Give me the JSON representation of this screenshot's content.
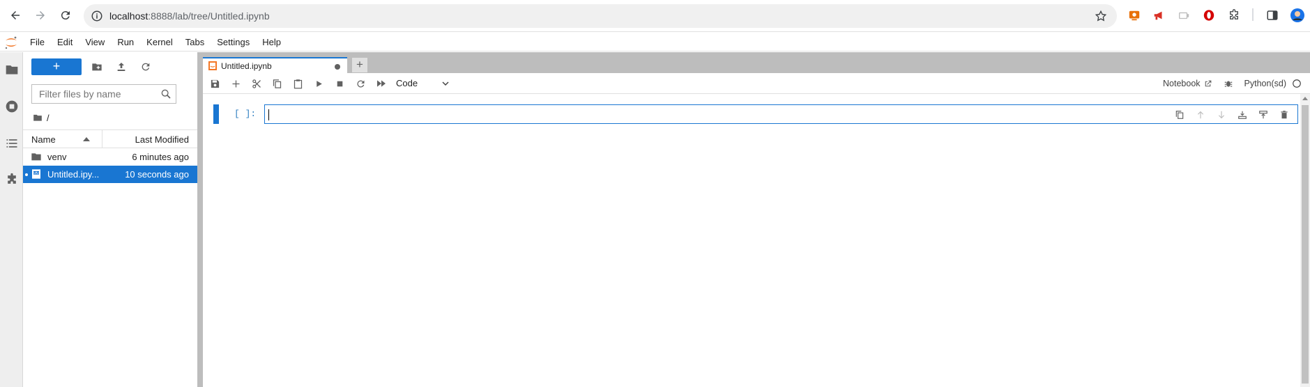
{
  "browser": {
    "url_host": "localhost",
    "url_path": ":8888/lab/tree/Untitled.ipynb"
  },
  "menubar": {
    "items": [
      "File",
      "Edit",
      "View",
      "Run",
      "Kernel",
      "Tabs",
      "Settings",
      "Help"
    ]
  },
  "filebrowser": {
    "new_label": "+",
    "filter_placeholder": "Filter files by name",
    "breadcrumb": "/",
    "columns": {
      "name": "Name",
      "modified": "Last Modified"
    },
    "rows": [
      {
        "name": "venv",
        "modified": "6 minutes ago",
        "icon": "folder-icon",
        "selected": false
      },
      {
        "name": "Untitled.ipy...",
        "modified": "10 seconds ago",
        "icon": "notebook-icon",
        "selected": true
      }
    ]
  },
  "notebook": {
    "tab_title": "Untitled.ipynb",
    "add_tab_label": "+",
    "cell_type": "Code",
    "notebook_label": "Notebook",
    "kernel_name": "Python(sd)",
    "cell_prompt": "[ ]:"
  },
  "colors": {
    "accent": "#1976d2",
    "prompt": "#307fc1",
    "splitter": "#bdbdbd"
  }
}
